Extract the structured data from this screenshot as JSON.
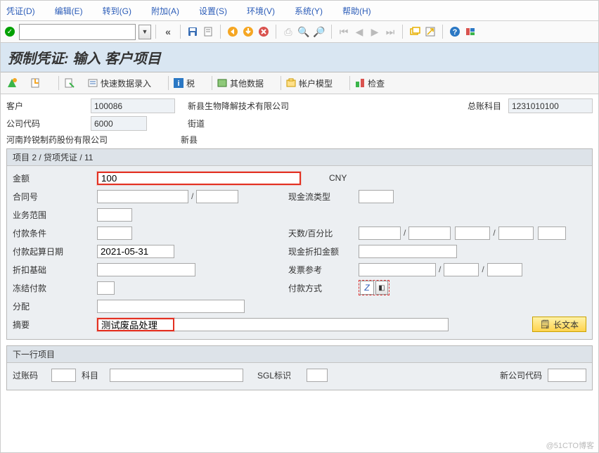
{
  "menu": {
    "doc": "凭证(D)",
    "edit": "编辑(E)",
    "goto": "转到(G)",
    "extras": "附加(A)",
    "settings": "设置(S)",
    "env": "环境(V)",
    "system": "系统(Y)",
    "help": "帮助(H)"
  },
  "toolbar1": {
    "cmd_value": "",
    "back_glyph": "«"
  },
  "title": "预制凭证: 输入 客户项目",
  "toolbar2": {
    "fast_entry": "快速数据录入",
    "tax": "税",
    "other_data": "其他数据",
    "acct_model": "帐户模型",
    "check": "检查"
  },
  "header": {
    "customer_lbl": "客户",
    "customer_val": "100086",
    "customer_name": "新县生物降解技术有限公司",
    "gl_lbl": "总账科目",
    "gl_val": "1231010100",
    "company_lbl": "公司代码",
    "company_val": "6000",
    "street_lbl": "街道",
    "company_name": "河南羚锐制药股份有限公司",
    "city": "新县"
  },
  "item_panel": {
    "title": "项目 2 / 贷项凭证 / 11",
    "amount_lbl": "金额",
    "amount_val": "100",
    "currency": "CNY",
    "contract_lbl": "合同号",
    "contract_no": "",
    "contract_item": "",
    "cashflow_lbl": "现金流类型",
    "cashflow_val": "",
    "busarea_lbl": "业务范围",
    "busarea_val": "",
    "payterm_lbl": "付款条件",
    "payterm_val": "",
    "days_lbl": "天数/百分比",
    "d1": "",
    "p1": "",
    "d2": "",
    "p2": "",
    "d3": "",
    "baseline_lbl": "付款起算日期",
    "baseline_val": "2021-05-31",
    "discamt_lbl": "现金折扣金额",
    "discamt_val": "",
    "discbase_lbl": "折扣基础",
    "discbase_val": "",
    "invref_lbl": "发票参考",
    "invref1": "",
    "invref2": "",
    "invref3": "",
    "pmtblock_lbl": "冻结付款",
    "pmtblock_val": "",
    "pmtmeth_lbl": "付款方式",
    "pmtmeth_val": "Z",
    "assign_lbl": "分配",
    "assign_val": "",
    "text_lbl": "摘要",
    "text_val": "测试废品处理",
    "longtext_btn": "长文本"
  },
  "next_panel": {
    "title": "下一行项目",
    "postkey_lbl": "过账码",
    "postkey_val": "",
    "account_lbl": "科目",
    "account_val": "",
    "sgl_lbl": "SGL标识",
    "sgl_val": "",
    "newco_lbl": "新公司代码",
    "newco_val": ""
  },
  "watermark": "@51CTO博客"
}
